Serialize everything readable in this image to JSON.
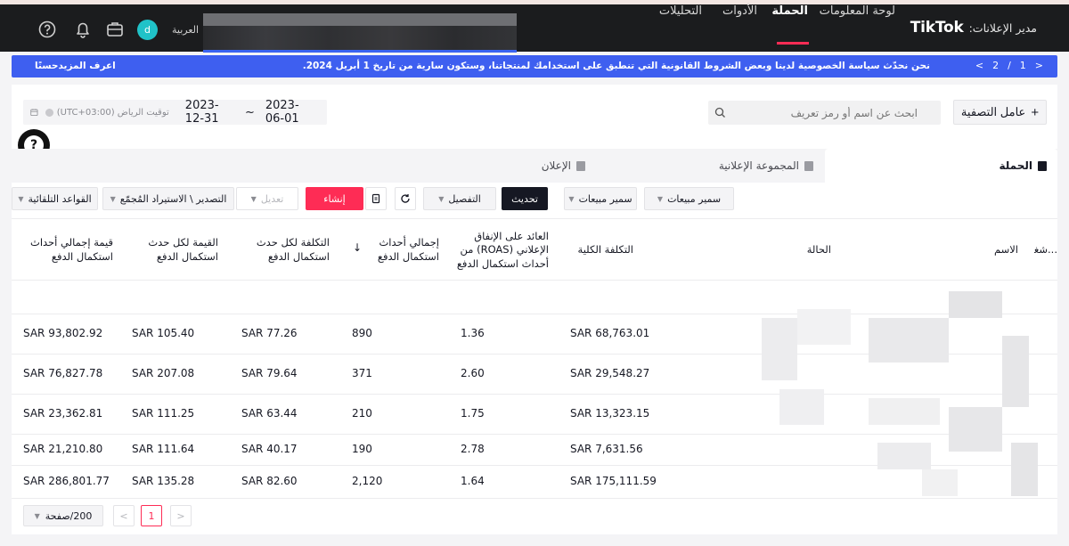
{
  "header": {
    "brand": "TikTok",
    "brand_sub": "مدير الإعلانات:",
    "nav": [
      {
        "label": "لوحة المعلومات",
        "active": false
      },
      {
        "label": "الحملة",
        "active": true
      },
      {
        "label": "الأدوات",
        "active": false
      },
      {
        "label": "التحليلات",
        "active": false
      }
    ],
    "language": "العربية",
    "avatar_initial": "d",
    "icons": [
      "briefcase-icon",
      "bell-icon",
      "help-circle-icon"
    ]
  },
  "announcement": {
    "message": "نحن نحدّث سياسة الخصوصية لدينا وبعض الشروط القانونية التي تنطبق على استخدامك لمنتجاتنا، وستكون سارية من تاريخ 1 أبريل 2024.",
    "learn_more": "اعرف المزيدحسنًا",
    "page_current": "1",
    "page_sep": "/",
    "page_total": "2",
    "prev": "<",
    "next": ">"
  },
  "filters": {
    "filter_button": "عامل التصفية",
    "search_placeholder": "ابحث عن اسم أو رمز تعريف",
    "date_start": "2023-06-01",
    "date_sep": "~",
    "date_end": "2023-12-31",
    "timezone": "(UTC+03:00) توقيت الرياض"
  },
  "tabs": [
    {
      "label": "الحملة",
      "active": true
    },
    {
      "label": "المجموعة الإعلانية",
      "active": false
    },
    {
      "label": "الإعلان",
      "active": false
    }
  ],
  "toolbar": {
    "smart_bid_1": "سمير مبيعات",
    "smart_bid_2": "سمير مبيعات",
    "update": "تحديث",
    "breakdown": "التفصيل",
    "create": "إنشاء",
    "edit": "تعديل",
    "export_import": "التصدير \\ الاستيراد المُجمّع",
    "auto_rules": "القواعد التلقائية"
  },
  "table": {
    "headers": {
      "op": "شغي...",
      "name": "الاسم",
      "status": "الحالة",
      "total_cost": "التكلفة الكلية",
      "roas": "العائد على الإنفاق الإعلاني (ROAS) من أحداث استكمال الدفع",
      "total_events": "إجمالي أحداث استكمال الدفع",
      "cost_per": "التكلفة لكل حدث استكمال الدفع",
      "value_per": "القيمة لكل حدث استكمال الدفع",
      "total_value": "قيمة إجمالي أحداث استكمال الدفع"
    },
    "sort_arrow": "↓",
    "rows": [
      {
        "total_cost": "SAR 68,763.01",
        "roas": "1.36",
        "events": "890",
        "cost_per": "SAR 77.26",
        "value_per": "SAR 105.40",
        "total_value": "SAR 93,802.92"
      },
      {
        "total_cost": "SAR 29,548.27",
        "roas": "2.60",
        "events": "371",
        "cost_per": "SAR 79.64",
        "value_per": "SAR 207.08",
        "total_value": "SAR 76,827.78"
      },
      {
        "total_cost": "SAR 13,323.15",
        "roas": "1.75",
        "events": "210",
        "cost_per": "SAR 63.44",
        "value_per": "SAR 111.25",
        "total_value": "SAR 23,362.81"
      },
      {
        "total_cost": "SAR 7,631.56",
        "roas": "2.78",
        "events": "190",
        "cost_per": "SAR 40.17",
        "value_per": "SAR 111.64",
        "total_value": "SAR 21,210.80"
      },
      {
        "total_cost": "SAR 175,111.59",
        "roas": "1.64",
        "events": "2,120",
        "cost_per": "SAR 82.60",
        "value_per": "SAR 135.28",
        "total_value": "SAR 286,801.77"
      }
    ]
  },
  "pagination": {
    "page_size": "200/صفحة",
    "current": "1",
    "prev": "<",
    "next": ">"
  },
  "help_fab": "?",
  "colors": {
    "accent": "#fe2c55",
    "banner": "#3e5ff0",
    "header": "#1b1c1e"
  }
}
